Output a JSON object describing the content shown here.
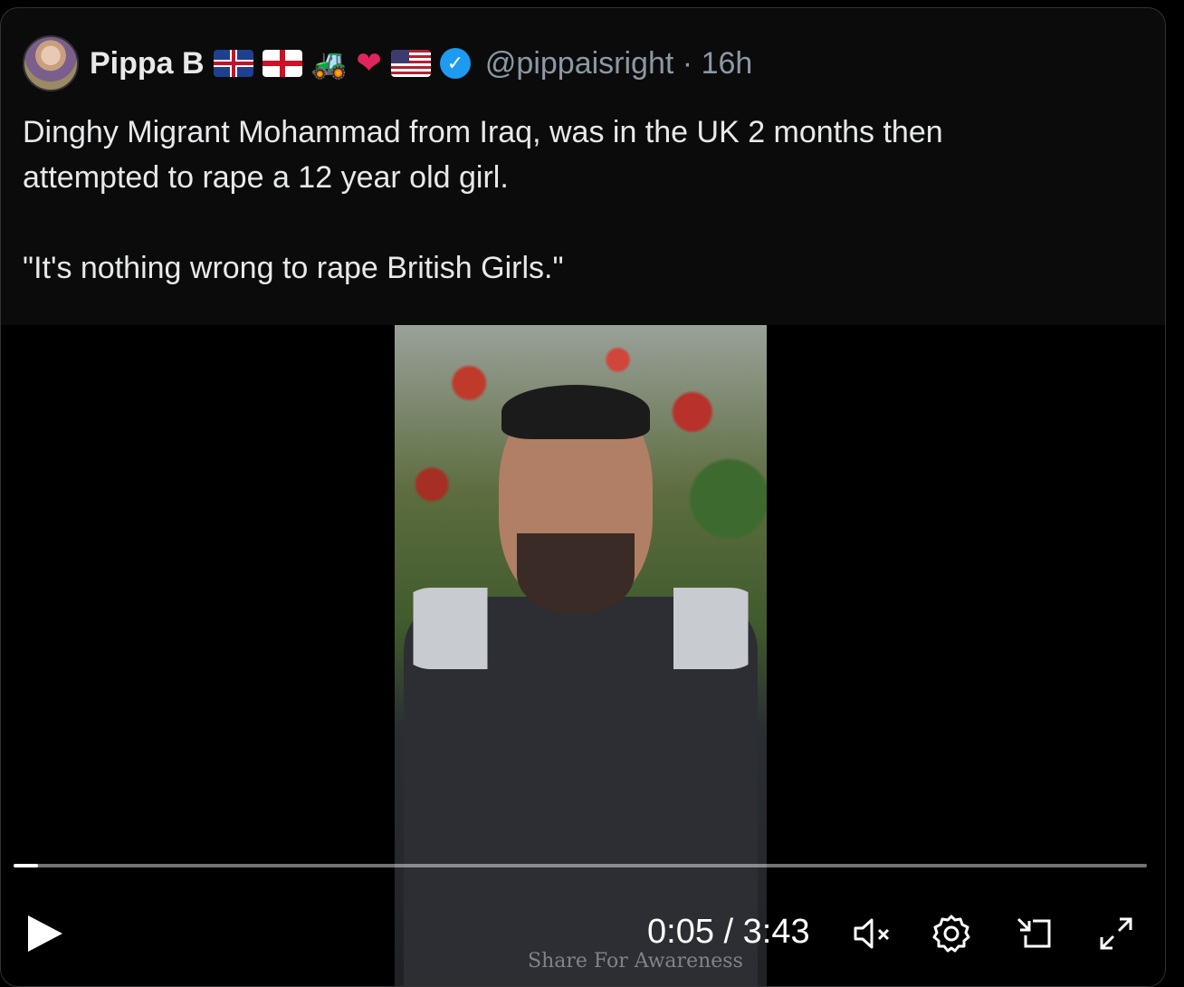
{
  "tweet": {
    "author_name": "Pippa B",
    "handle": "@pippaisright",
    "separator": "·",
    "time": "16h",
    "badges": [
      "uk-flag-icon",
      "england-flag-icon",
      "tractor-icon",
      "heart-icon",
      "us-flag-icon",
      "verified-icon"
    ],
    "text_line1": "Dinghy Migrant Mohammad from Iraq, was in the UK 2 months then",
    "text_line2": "attempted to rape a 12 year old girl.",
    "text_line3": "\"It's nothing wrong to rape British Girls.\""
  },
  "video": {
    "watermark": "Share For Awareness",
    "current_time": "0:05",
    "time_separator": "/",
    "duration": "3:43",
    "progress_fraction": 0.0215,
    "controls": [
      "play-icon",
      "mute-icon",
      "settings-icon",
      "pip-icon",
      "fullscreen-icon"
    ]
  },
  "colors": {
    "verified": "#1d9bf0",
    "handle": "#8b98a5",
    "background": "#000000"
  }
}
